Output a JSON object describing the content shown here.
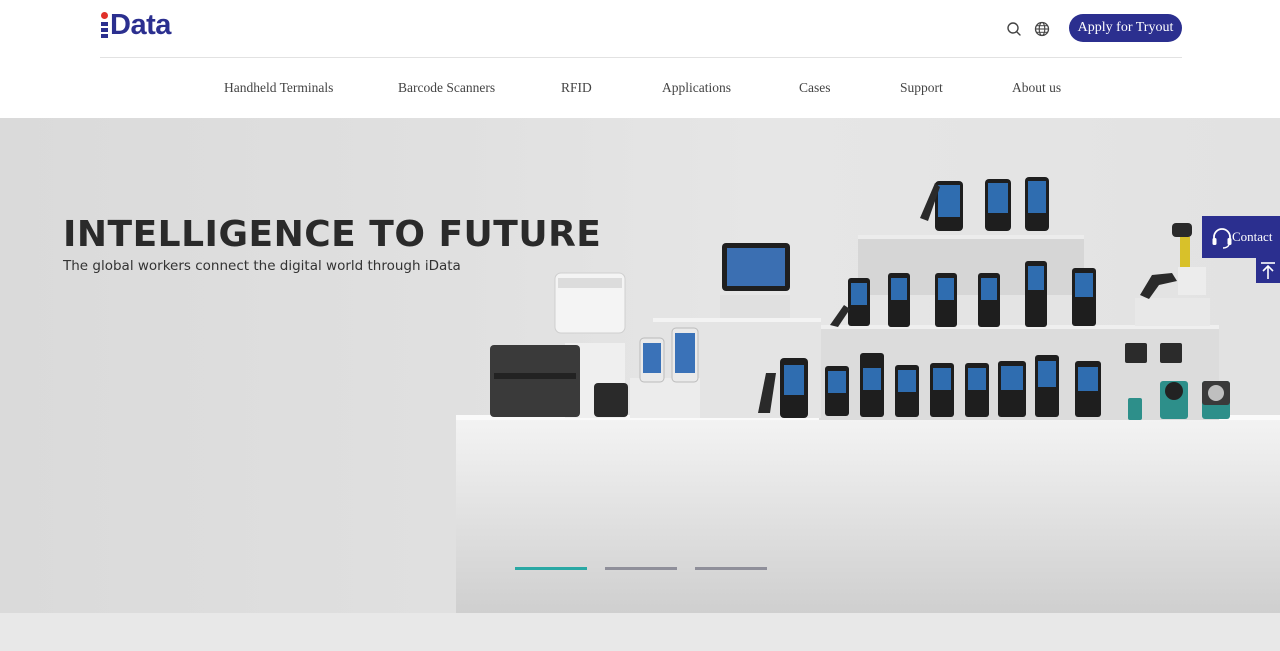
{
  "header": {
    "logo_text": "Data",
    "apply_label": "Apply for Tryout",
    "search_icon": "search-icon",
    "globe_icon": "globe-icon"
  },
  "nav": {
    "items": [
      {
        "label": "Handheld Terminals"
      },
      {
        "label": "Barcode Scanners"
      },
      {
        "label": "RFID"
      },
      {
        "label": "Applications"
      },
      {
        "label": "Cases"
      },
      {
        "label": "Support"
      },
      {
        "label": "About us"
      }
    ]
  },
  "hero": {
    "title": "INTELLIGENCE TO FUTURE",
    "subtitle": "The global workers connect the digital world through iData",
    "slides": [
      {
        "active": true
      },
      {
        "active": false
      },
      {
        "active": false
      }
    ]
  },
  "side": {
    "contact_label": "Contact",
    "contact_icon": "headset-icon",
    "top_icon": "arrow-up-to-top-icon"
  },
  "colors": {
    "brand": "#2b2f8f",
    "accent_teal": "#2aa8a4",
    "logo_red": "#e0302a",
    "indicator_inactive": "#8f8f9a"
  }
}
